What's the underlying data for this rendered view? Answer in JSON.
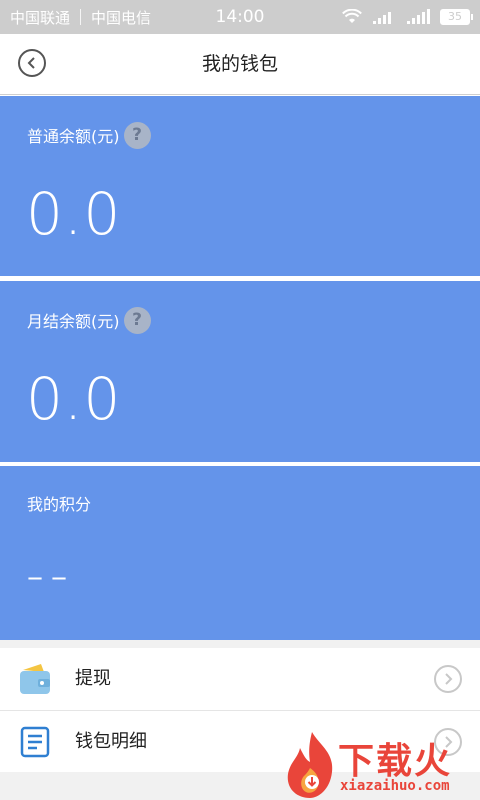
{
  "status_bar": {
    "carrier1": "中国联通",
    "carrier2": "中国电信",
    "time": "14:00",
    "battery": "35"
  },
  "header": {
    "title": "我的钱包"
  },
  "panels": [
    {
      "label": "普通余额(元)",
      "value": "0.0",
      "help": "?"
    },
    {
      "label": "月结余额(元)",
      "value": "0.0",
      "help": "?"
    },
    {
      "label": "我的积分",
      "value": "--"
    }
  ],
  "list": [
    {
      "label": "提现"
    },
    {
      "label": "钱包明细"
    }
  ],
  "watermark": {
    "text_cn": "下载火",
    "text_en": "xiazaihuo.com"
  },
  "colors": {
    "panel_blue": "#6494ea",
    "status_gray": "#cdcdcd",
    "watermark_red": "#e9453a"
  }
}
